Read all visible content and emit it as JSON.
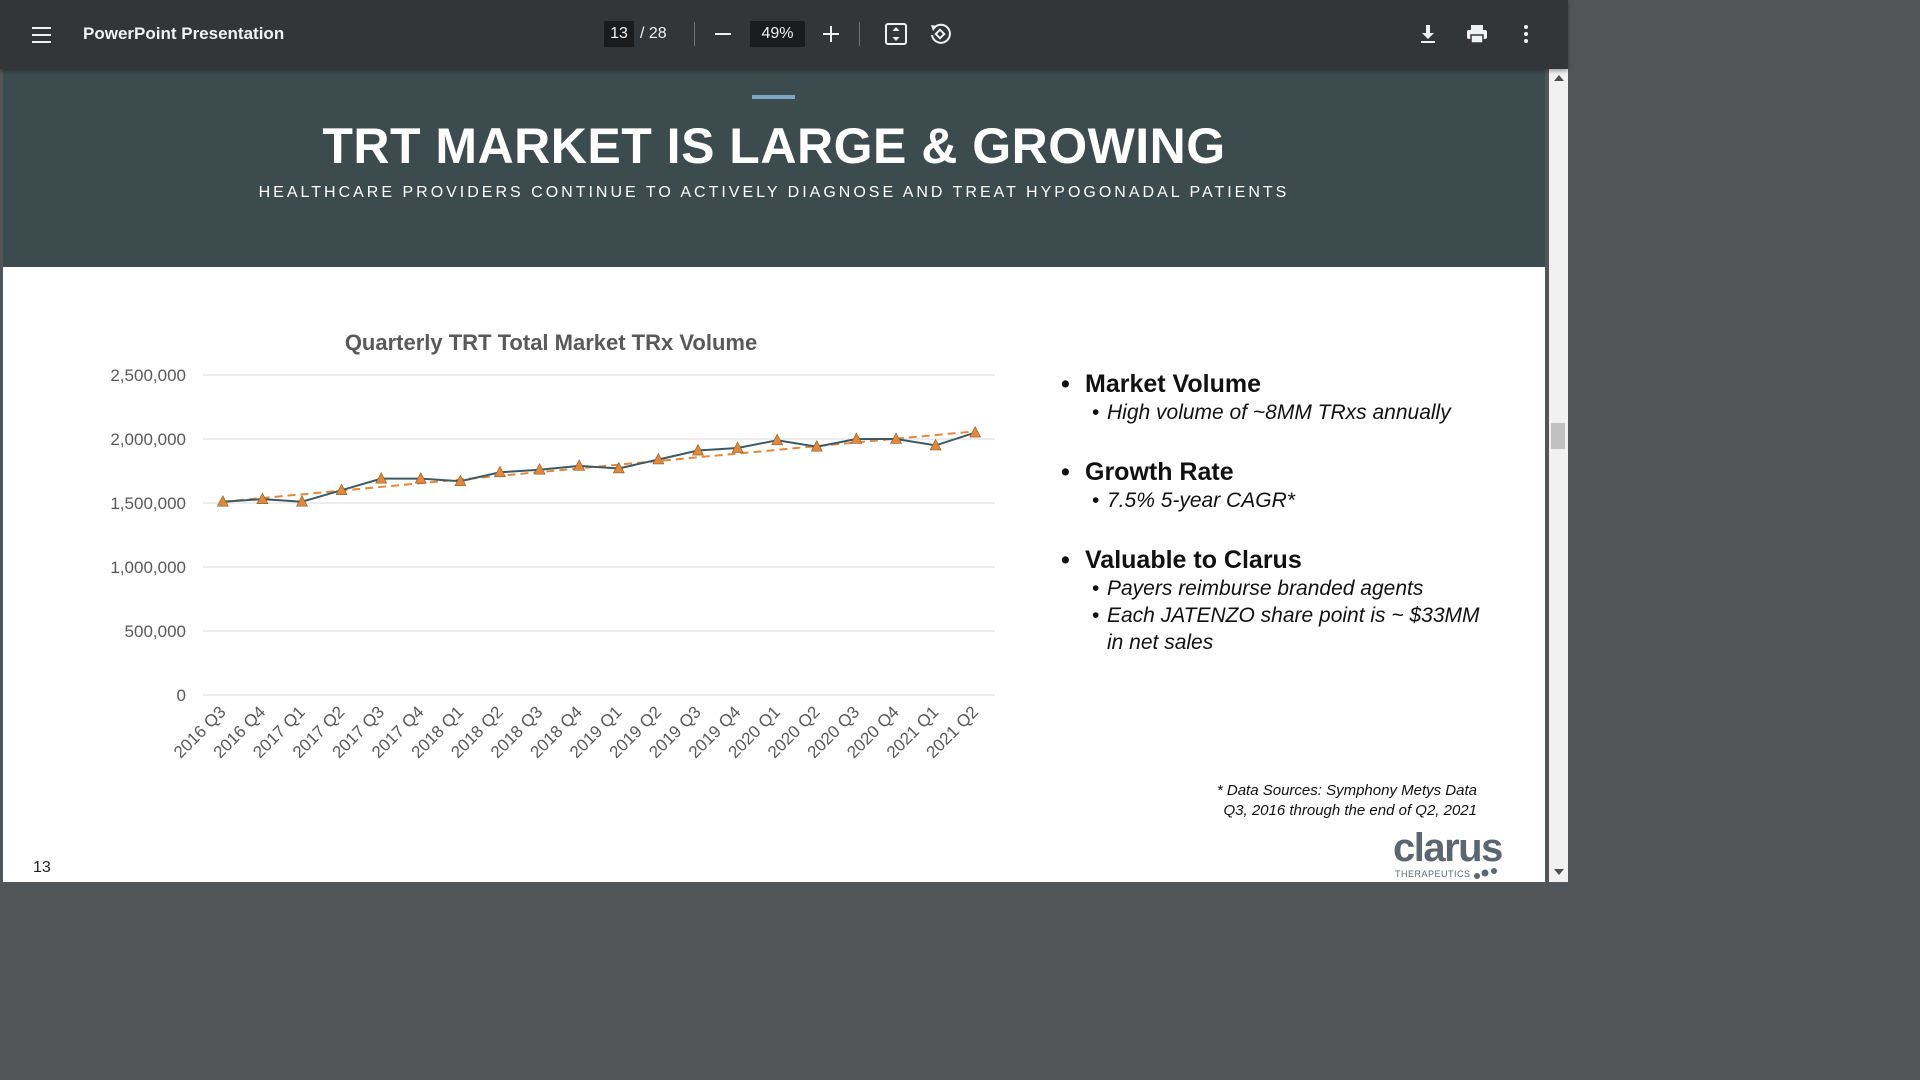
{
  "toolbar": {
    "title": "PowerPoint Presentation",
    "page_current": "13",
    "page_total": "/ 28",
    "zoom": "49%",
    "icons": [
      "menu-icon",
      "zoom-out-icon",
      "zoom-in-icon",
      "fit-page-icon",
      "rotate-icon",
      "download-icon",
      "print-icon",
      "more-vert-icon"
    ]
  },
  "slide": {
    "title": "TRT MARKET IS LARGE & GROWING",
    "subtitle": "HEALTHCARE PROVIDERS CONTINUE TO ACTIVELY DIAGNOSE AND TREAT HYPOGONADAL PATIENTS",
    "header_color": "#3c4b4d",
    "accent_color": "#7ea6c4",
    "bullets": [
      {
        "head": "Market Volume",
        "subs": [
          "High volume of ~8MM TRxs annually"
        ]
      },
      {
        "head": "Growth Rate",
        "subs": [
          "7.5% 5-year CAGR*"
        ]
      },
      {
        "head": "Valuable to Clarus",
        "subs": [
          "Payers reimburse branded agents",
          "Each JATENZO share point is ~ $33MM in net sales"
        ]
      }
    ],
    "footnote_line1": "* Data Sources: Symphony Metys Data",
    "footnote_line2": "Q3, 2016 through the end of Q2, 2021",
    "page_number": "13",
    "logo_word": "clarus",
    "logo_tagline": "THERAPEUTICS"
  },
  "chart_data": {
    "type": "line",
    "title": "Quarterly TRT Total Market TRx Volume",
    "xlabel": "",
    "ylabel": "",
    "categories": [
      "2016 Q3",
      "2016 Q4",
      "2017 Q1",
      "2017 Q2",
      "2017 Q3",
      "2017 Q4",
      "2018 Q1",
      "2018 Q2",
      "2018 Q3",
      "2018 Q4",
      "2019 Q1",
      "2019 Q2",
      "2019 Q3",
      "2019 Q4",
      "2020 Q1",
      "2020 Q2",
      "2020 Q3",
      "2020 Q4",
      "2021 Q1",
      "2021 Q2"
    ],
    "series": [
      {
        "values": [
          1510000,
          1530000,
          1510000,
          1600000,
          1690000,
          1690000,
          1670000,
          1740000,
          1760000,
          1790000,
          1770000,
          1840000,
          1910000,
          1930000,
          1990000,
          1940000,
          2000000,
          2000000,
          1950000,
          2050000
        ],
        "color": "#3c5a64",
        "marker": "triangle",
        "marker_color": "#e0893c"
      }
    ],
    "trendline": {
      "start": 1510000,
      "end": 2060000,
      "color": "#e0893c",
      "style": "dashed"
    },
    "ylim": [
      0,
      2500000
    ],
    "yticks": [
      0,
      500000,
      1000000,
      1500000,
      2000000,
      2500000
    ],
    "ytick_labels": [
      "0",
      "500,000",
      "1,000,000",
      "1,500,000",
      "2,000,000",
      "2,500,000"
    ],
    "grid": true,
    "legend": "none"
  }
}
